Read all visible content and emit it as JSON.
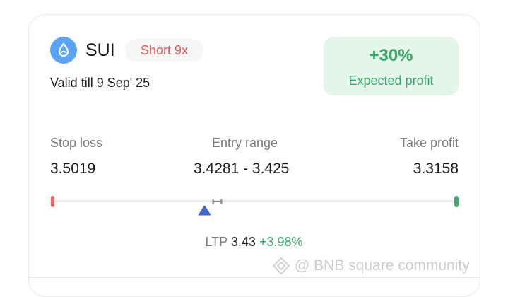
{
  "asset": {
    "icon": "sui-droplet-icon",
    "icon_color": "#5aa4f3",
    "name": "SUI",
    "direction_badge": "Short 9x",
    "valid_till": "Valid till 9 Sep' 25"
  },
  "profit": {
    "value": "+30%",
    "label": "Expected profit"
  },
  "levels": {
    "stop_loss": {
      "label": "Stop loss",
      "value": "3.5019"
    },
    "entry_range": {
      "label": "Entry range",
      "value": "3.4281 - 3.425"
    },
    "take_profit": {
      "label": "Take profit",
      "value": "3.3158"
    }
  },
  "ltp": {
    "label": "LTP",
    "price": "3.43",
    "change": "+3.98%"
  },
  "watermark": "@ BNB square community",
  "colors": {
    "loss": "#e36a6a",
    "profit": "#3aa66a",
    "pointer": "#4166d5"
  }
}
